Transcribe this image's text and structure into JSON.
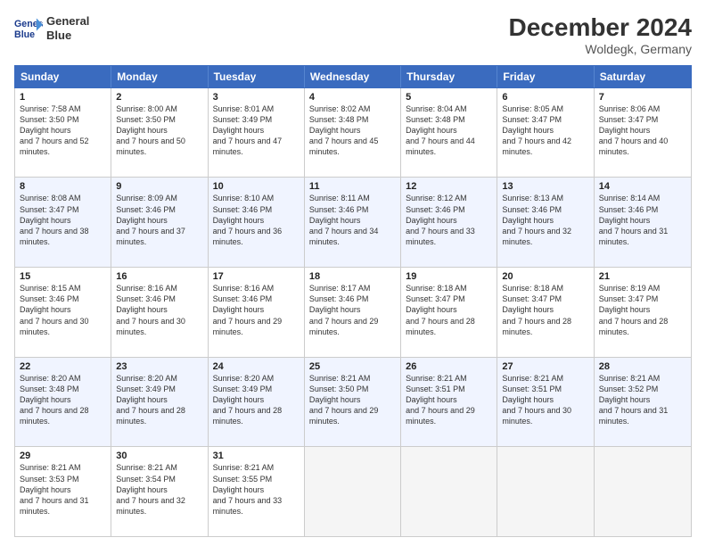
{
  "header": {
    "logo_line1": "General",
    "logo_line2": "Blue",
    "main_title": "December 2024",
    "subtitle": "Woldegk, Germany"
  },
  "days": [
    "Sunday",
    "Monday",
    "Tuesday",
    "Wednesday",
    "Thursday",
    "Friday",
    "Saturday"
  ],
  "weeks": [
    [
      {
        "day": "1",
        "rise": "7:58 AM",
        "set": "3:50 PM",
        "light": "7 hours and 52 minutes."
      },
      {
        "day": "2",
        "rise": "8:00 AM",
        "set": "3:50 PM",
        "light": "7 hours and 50 minutes."
      },
      {
        "day": "3",
        "rise": "8:01 AM",
        "set": "3:49 PM",
        "light": "7 hours and 47 minutes."
      },
      {
        "day": "4",
        "rise": "8:02 AM",
        "set": "3:48 PM",
        "light": "7 hours and 45 minutes."
      },
      {
        "day": "5",
        "rise": "8:04 AM",
        "set": "3:48 PM",
        "light": "7 hours and 44 minutes."
      },
      {
        "day": "6",
        "rise": "8:05 AM",
        "set": "3:47 PM",
        "light": "7 hours and 42 minutes."
      },
      {
        "day": "7",
        "rise": "8:06 AM",
        "set": "3:47 PM",
        "light": "7 hours and 40 minutes."
      }
    ],
    [
      {
        "day": "8",
        "rise": "8:08 AM",
        "set": "3:47 PM",
        "light": "7 hours and 38 minutes."
      },
      {
        "day": "9",
        "rise": "8:09 AM",
        "set": "3:46 PM",
        "light": "7 hours and 37 minutes."
      },
      {
        "day": "10",
        "rise": "8:10 AM",
        "set": "3:46 PM",
        "light": "7 hours and 36 minutes."
      },
      {
        "day": "11",
        "rise": "8:11 AM",
        "set": "3:46 PM",
        "light": "7 hours and 34 minutes."
      },
      {
        "day": "12",
        "rise": "8:12 AM",
        "set": "3:46 PM",
        "light": "7 hours and 33 minutes."
      },
      {
        "day": "13",
        "rise": "8:13 AM",
        "set": "3:46 PM",
        "light": "7 hours and 32 minutes."
      },
      {
        "day": "14",
        "rise": "8:14 AM",
        "set": "3:46 PM",
        "light": "7 hours and 31 minutes."
      }
    ],
    [
      {
        "day": "15",
        "rise": "8:15 AM",
        "set": "3:46 PM",
        "light": "7 hours and 30 minutes."
      },
      {
        "day": "16",
        "rise": "8:16 AM",
        "set": "3:46 PM",
        "light": "7 hours and 30 minutes."
      },
      {
        "day": "17",
        "rise": "8:16 AM",
        "set": "3:46 PM",
        "light": "7 hours and 29 minutes."
      },
      {
        "day": "18",
        "rise": "8:17 AM",
        "set": "3:46 PM",
        "light": "7 hours and 29 minutes."
      },
      {
        "day": "19",
        "rise": "8:18 AM",
        "set": "3:47 PM",
        "light": "7 hours and 28 minutes."
      },
      {
        "day": "20",
        "rise": "8:18 AM",
        "set": "3:47 PM",
        "light": "7 hours and 28 minutes."
      },
      {
        "day": "21",
        "rise": "8:19 AM",
        "set": "3:47 PM",
        "light": "7 hours and 28 minutes."
      }
    ],
    [
      {
        "day": "22",
        "rise": "8:20 AM",
        "set": "3:48 PM",
        "light": "7 hours and 28 minutes."
      },
      {
        "day": "23",
        "rise": "8:20 AM",
        "set": "3:49 PM",
        "light": "7 hours and 28 minutes."
      },
      {
        "day": "24",
        "rise": "8:20 AM",
        "set": "3:49 PM",
        "light": "7 hours and 28 minutes."
      },
      {
        "day": "25",
        "rise": "8:21 AM",
        "set": "3:50 PM",
        "light": "7 hours and 29 minutes."
      },
      {
        "day": "26",
        "rise": "8:21 AM",
        "set": "3:51 PM",
        "light": "7 hours and 29 minutes."
      },
      {
        "day": "27",
        "rise": "8:21 AM",
        "set": "3:51 PM",
        "light": "7 hours and 30 minutes."
      },
      {
        "day": "28",
        "rise": "8:21 AM",
        "set": "3:52 PM",
        "light": "7 hours and 31 minutes."
      }
    ],
    [
      {
        "day": "29",
        "rise": "8:21 AM",
        "set": "3:53 PM",
        "light": "7 hours and 31 minutes."
      },
      {
        "day": "30",
        "rise": "8:21 AM",
        "set": "3:54 PM",
        "light": "7 hours and 32 minutes."
      },
      {
        "day": "31",
        "rise": "8:21 AM",
        "set": "3:55 PM",
        "light": "7 hours and 33 minutes."
      },
      null,
      null,
      null,
      null
    ]
  ]
}
